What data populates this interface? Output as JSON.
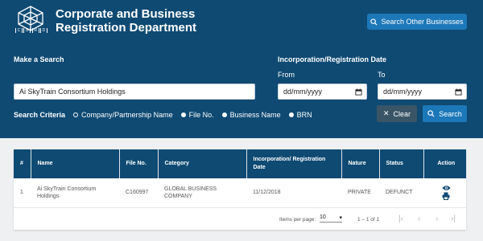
{
  "header": {
    "logo_letters": [
      "C",
      "B",
      "R",
      "D"
    ],
    "title": "Corporate and Business Registration Department",
    "other_businesses_button": "Search Other Businesses"
  },
  "search": {
    "section_label": "Make a Search",
    "query_value": "Ai SkyTrain Consortium Holdings",
    "date_section_label": "Incorporation/Registration Date",
    "from_label": "From",
    "to_label": "To",
    "from_placeholder": "dd/mm/yyyy",
    "to_placeholder": "dd/mm/yyyy",
    "criteria_label": "Search Criteria",
    "criteria_options": [
      {
        "label": "Company/Partnership Name",
        "selected": true
      },
      {
        "label": "File No.",
        "selected": false
      },
      {
        "label": "Business Name",
        "selected": false
      },
      {
        "label": "BRN",
        "selected": false
      }
    ],
    "clear_label": "Clear",
    "search_label": "Search"
  },
  "results": {
    "columns": [
      "#",
      "Name",
      "File No.",
      "Category",
      "Incorporation/ Registration Date",
      "Nature",
      "Status",
      "Action"
    ],
    "rows": [
      {
        "num": "1",
        "name": "Ai SkyTrain Consortium Holdings",
        "file_no": "C160997",
        "category": "GLOBAL BUSINESS COMPANY",
        "date": "11/12/2018",
        "nature": "PRIVATE",
        "status": "DEFUNCT"
      }
    ],
    "pagination": {
      "items_per_page_label": "Items per page:",
      "items_per_page": "10",
      "range": "1 – 1 of 1"
    }
  },
  "colors": {
    "header_bg": "#0f4a73",
    "primary_button": "#1c78b8",
    "clear_button": "#3a5566"
  }
}
